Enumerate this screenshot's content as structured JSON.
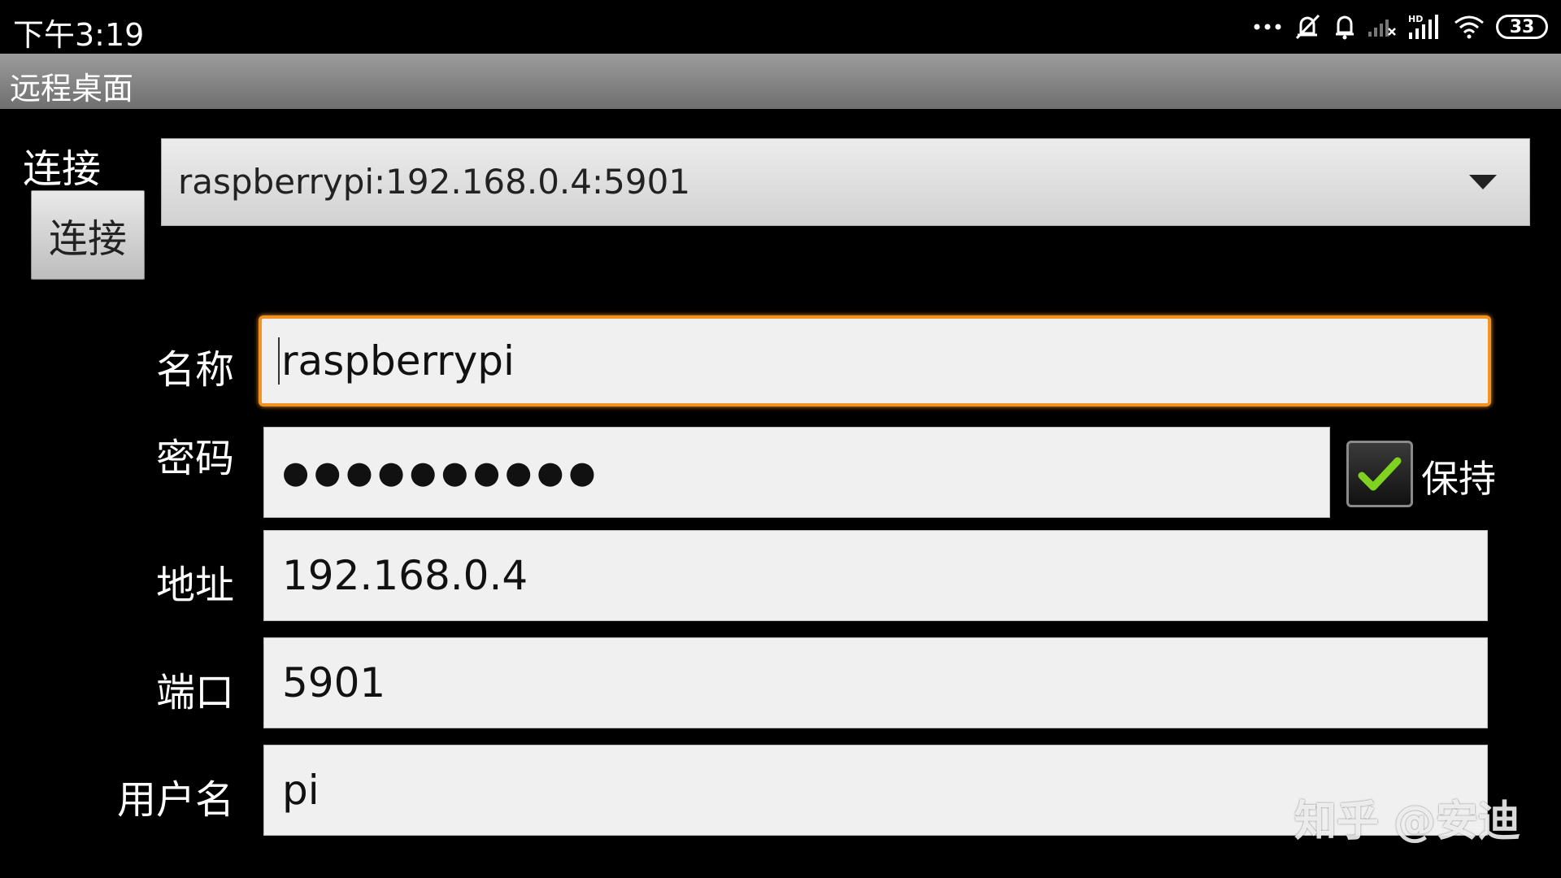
{
  "status_bar": {
    "time": "下午3:19",
    "battery": "33",
    "icons": [
      "more-dots-icon",
      "silent-bell-icon",
      "bell-icon",
      "signal-x-icon",
      "hd-signal-icon",
      "wifi-icon",
      "battery-icon"
    ]
  },
  "title_bar": {
    "title": "远程桌面"
  },
  "connection": {
    "label": "连接",
    "button_label": "连接",
    "selected_value": "raspberrypi:192.168.0.4:5901"
  },
  "form": {
    "name": {
      "label": "名称",
      "value": "raspberrypi"
    },
    "password": {
      "label": "密码",
      "value": "●●●●●●●●●●"
    },
    "keep": {
      "label": "保持",
      "checked": true
    },
    "address": {
      "label": "地址",
      "value": "192.168.0.4"
    },
    "port": {
      "label": "端口",
      "value": "5901"
    },
    "username": {
      "label": "用户名",
      "value": "pi"
    }
  },
  "watermark": "知乎 @安迪",
  "colors": {
    "focus_border": "#f29222",
    "check_green": "#7fd21f",
    "title_bar": "#8a8a8a"
  }
}
